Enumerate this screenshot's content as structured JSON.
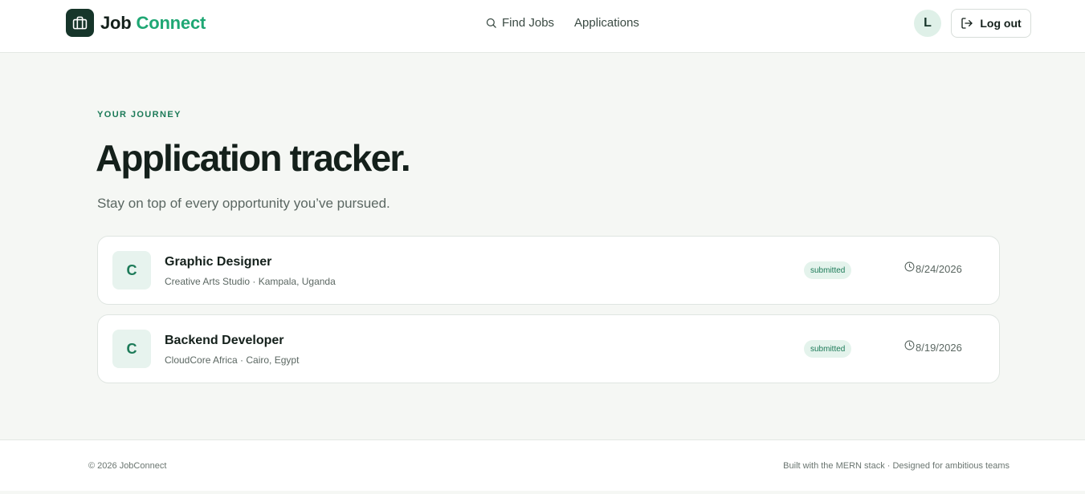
{
  "header": {
    "brand_part1": "Job",
    "brand_part2": "Connect",
    "logo_icon": "briefcase-icon",
    "nav": [
      {
        "label": "Find Jobs",
        "icon": "search-icon"
      },
      {
        "label": "Applications"
      }
    ],
    "avatar_initial": "L",
    "logout_label": "Log out",
    "logout_icon": "log-out-icon"
  },
  "main": {
    "eyebrow": "YOUR JOURNEY",
    "title": "Application tracker.",
    "subtitle": "Stay on top of every opportunity you’ve pursued.",
    "applications": [
      {
        "initial": "C",
        "title": "Graphic Designer",
        "meta": "Creative Arts Studio · Kampala, Uganda",
        "status": "submitted",
        "date": "8/24/2026"
      },
      {
        "initial": "C",
        "title": "Backend Developer",
        "meta": "CloudCore Africa · Cairo, Egypt",
        "status": "submitted",
        "date": "8/19/2026"
      }
    ]
  },
  "footer": {
    "copyright": "© 2026 JobConnect",
    "tagline": "Built with the MERN stack · Designed for ambitious teams"
  },
  "colors": {
    "brand_dark": "#16352a",
    "accent": "#1fa774",
    "status_bg": "#e4f3ec",
    "page_bg": "#f5f7f4"
  }
}
